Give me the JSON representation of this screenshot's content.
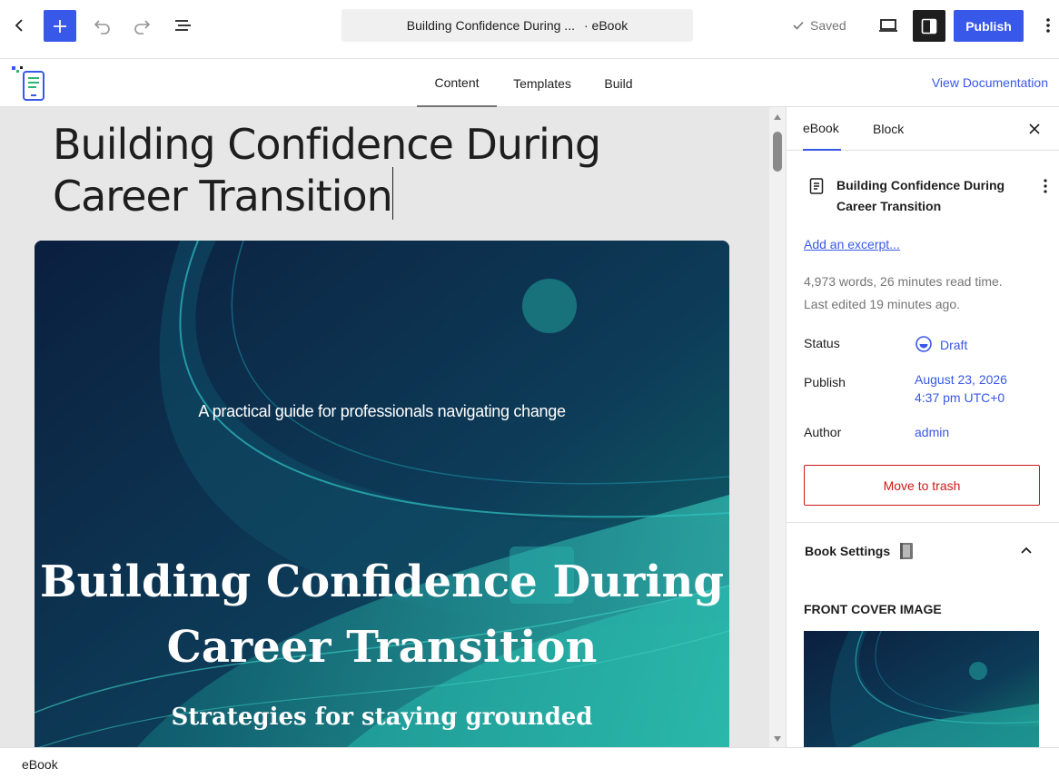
{
  "toolbar": {
    "doc_title": "Building Confidence During ...",
    "doc_type": "· eBook",
    "saved_label": "Saved",
    "publish_label": "Publish"
  },
  "nav": {
    "tabs": [
      "Content",
      "Templates",
      "Build"
    ],
    "active_tab": "Content",
    "view_documentation": "View Documentation"
  },
  "editor": {
    "post_title": "Building Confidence During Career Transition",
    "cover": {
      "subtitle": "A practical guide for professionals navigating change",
      "title": "Building Confidence During Career Transition",
      "tagline": "Strategies for staying grounded"
    }
  },
  "sidebar": {
    "tabs": [
      "eBook",
      "Block"
    ],
    "active_tab": "eBook",
    "post_title": "Building Confidence During Career Transition",
    "add_excerpt": "Add an excerpt...",
    "stats": "4,973 words, 26 minutes read time.",
    "last_edited": "Last edited 19 minutes ago.",
    "status_label": "Status",
    "status_value": "Draft",
    "publish_label": "Publish",
    "publish_date": "August 23, 2026",
    "publish_time": "4:37 pm UTC+0",
    "author_label": "Author",
    "author_value": "admin",
    "trash_label": "Move to trash",
    "book_settings": "Book Settings",
    "front_cover_label": "FRONT COVER IMAGE"
  },
  "footer": {
    "breadcrumb": "eBook"
  },
  "colors": {
    "accent": "#3858e9",
    "danger": "#cc1818",
    "cover_bg": "#0c2a4a",
    "cover_teal": "#1bb8a8"
  }
}
